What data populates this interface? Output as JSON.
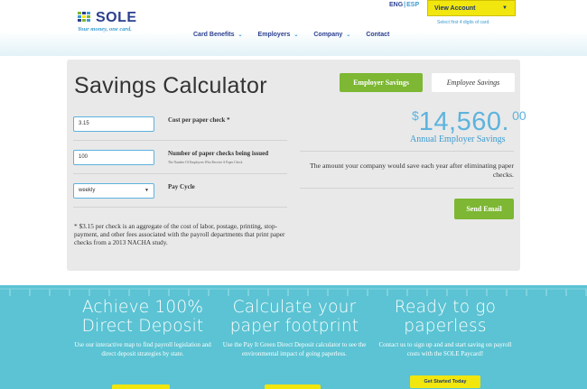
{
  "header": {
    "logo": {
      "wordmark": "SOLE",
      "tagline": "Your money, one card."
    },
    "nav": [
      {
        "label": "Card Benefits",
        "has_dropdown": true
      },
      {
        "label": "Employers",
        "has_dropdown": true
      },
      {
        "label": "Company",
        "has_dropdown": true
      },
      {
        "label": "Contact",
        "has_dropdown": false
      }
    ],
    "language": {
      "active": "ENG",
      "separator": "|",
      "other": "ESP"
    },
    "account_button": "View Account",
    "account_hint": "Select first 4 digits of card."
  },
  "calculator": {
    "title": "Savings Calculator",
    "tab_employer": "Employer Savings",
    "tab_employee": "Employee Savings",
    "cost_value": "3.15",
    "cost_label": "Cost per paper check *",
    "checks_value": "100",
    "checks_label": "Number of paper checks being issued",
    "checks_sublabel": "The Number Of Employees Who Receive A Paper Check",
    "cycle_value": "weekly",
    "cycle_label": "Pay Cycle",
    "footnote": "* $3.15 per check is an aggregate of the cost of labor, postage, printing, stop-payment, and other fees associated with the payroll departments that print paper checks from a 2013 NACHA study.",
    "savings_currency": "$",
    "savings_whole": "14,560.",
    "savings_cents": "00",
    "savings_label": "Annual Employer Savings",
    "summary": "The amount your company would save each year after eliminating paper checks.",
    "send_email": "Send Email"
  },
  "promo": {
    "columns": [
      {
        "title": "Achieve 100% Direct Deposit",
        "desc": "Use our interactive map to find payroll legislation and direct deposit strategies by state."
      },
      {
        "title": "Calculate your paper footprint",
        "desc": "Use the Pay It Green Direct Deposit calculator to see the environmental impact of going paperless."
      },
      {
        "title": "Ready to go paperless",
        "desc": "Contact us to sign up and and start saving on payroll costs with the SOLE Paycard!"
      }
    ],
    "get_started": "Get Started Today"
  },
  "colors": {
    "brand_navy": "#2a3f8f",
    "brand_blue": "#3b9bd1",
    "accent_green": "#7db733",
    "accent_yellow": "#f1e60e",
    "band_teal": "#5bc3d3"
  }
}
